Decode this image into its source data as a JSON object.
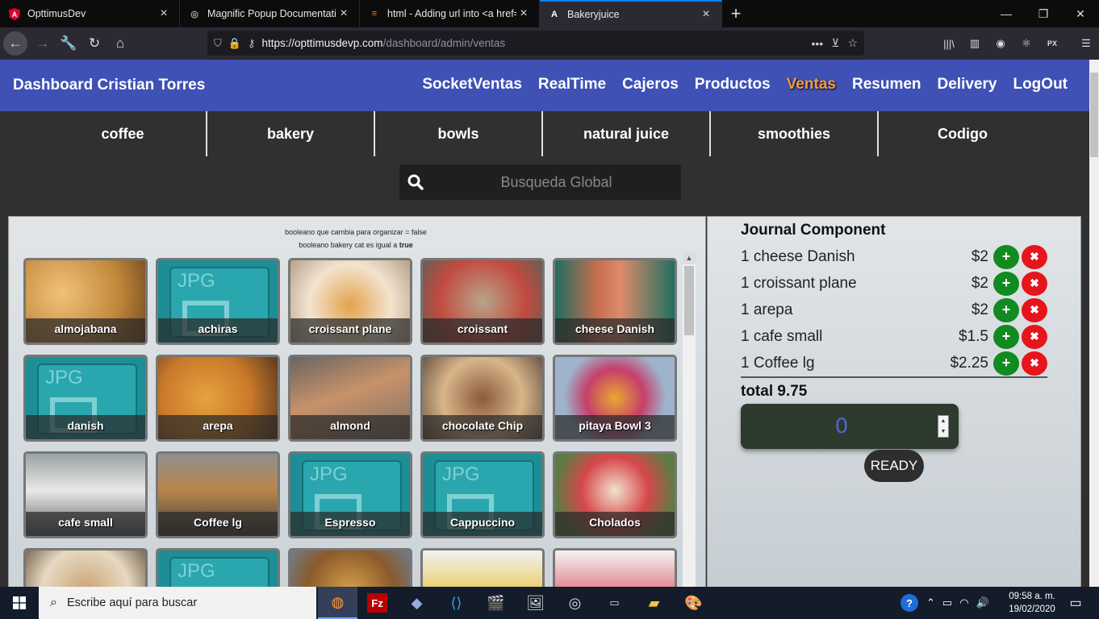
{
  "browser": {
    "tabs": [
      {
        "title": "OpttimusDev",
        "icon": "angular-icon"
      },
      {
        "title": "Magnific Popup Documentation",
        "icon": "popup-icon"
      },
      {
        "title": "html - Adding url into <a href=",
        "icon": "stackoverflow-icon"
      },
      {
        "title": "Bakeryjuice",
        "icon": "angular-icon"
      }
    ],
    "url_host": "https://opttimusdevp.com",
    "url_path": "/dashboard/admin/ventas"
  },
  "header": {
    "brand": "Dashboard Cristian Torres",
    "nav": [
      "SocketVentas",
      "RealTime",
      "Cajeros",
      "Productos",
      "Ventas",
      "Resumen",
      "Delivery",
      "LogOut"
    ],
    "active_nav": "Ventas"
  },
  "categories": [
    "coffee",
    "bakery",
    "bowls",
    "natural juice",
    "smoothies",
    "Codigo"
  ],
  "search": {
    "placeholder": "Busqueda Global"
  },
  "debug": {
    "line1": "booleano que cambia para organizar = false",
    "line2_prefix": "booleano bakery cat es igual a",
    "line2_value": "true"
  },
  "products": [
    {
      "name": "almojabana",
      "image": "photo"
    },
    {
      "name": "achiras",
      "image": "jpg-placeholder"
    },
    {
      "name": "croissant plane",
      "image": "photo"
    },
    {
      "name": "croissant",
      "image": "photo"
    },
    {
      "name": "cheese Danish",
      "image": "photo"
    },
    {
      "name": "danish",
      "image": "jpg-placeholder"
    },
    {
      "name": "arepa",
      "image": "photo"
    },
    {
      "name": "almond",
      "image": "photo"
    },
    {
      "name": "chocolate Chip",
      "image": "photo"
    },
    {
      "name": "pitaya Bowl 3",
      "image": "photo"
    },
    {
      "name": "cafe small",
      "image": "photo"
    },
    {
      "name": "Coffee lg",
      "image": "photo"
    },
    {
      "name": "Espresso",
      "image": "jpg-placeholder"
    },
    {
      "name": "Cappuccino",
      "image": "jpg-placeholder"
    },
    {
      "name": "Cholados",
      "image": "photo"
    },
    {
      "name": "",
      "image": "photo"
    },
    {
      "name": "",
      "image": "jpg-placeholder"
    },
    {
      "name": "",
      "image": "photo"
    },
    {
      "name": "",
      "image": "photo"
    },
    {
      "name": "",
      "image": "photo"
    }
  ],
  "journal": {
    "title": "Journal Component",
    "items": [
      {
        "name": "1 cheese Danish",
        "price": "$2"
      },
      {
        "name": "1 croissant plane",
        "price": "$2"
      },
      {
        "name": "1 arepa",
        "price": "$2"
      },
      {
        "name": "1 cafe small",
        "price": "$1.5"
      },
      {
        "name": "1 Coffee lg",
        "price": "$2.25"
      }
    ],
    "total": "total 9.75",
    "input_value": "0",
    "ready_label": "READY"
  },
  "taskbar": {
    "search_placeholder": "Escribe aquí para buscar",
    "time": "09:58 a. m.",
    "date": "19/02/2020"
  },
  "colors": {
    "header_bg": "#3f51b5",
    "active_nav": "#f39c40",
    "add_button": "#118a1f",
    "remove_button": "#e8141c"
  }
}
